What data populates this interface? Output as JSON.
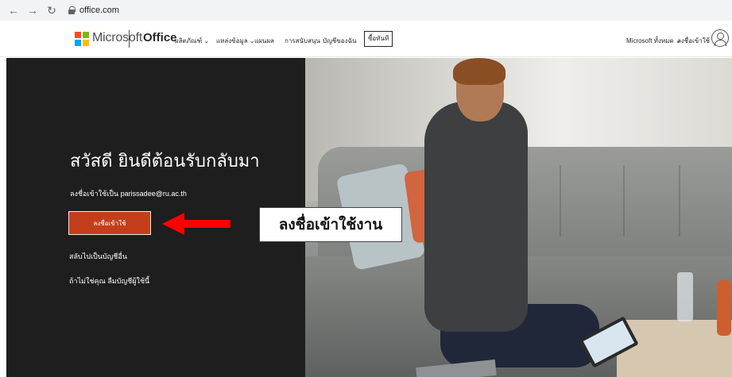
{
  "browser": {
    "url": "office.com",
    "icons": {
      "back": "arrow-left-icon",
      "forward": "arrow-right-icon",
      "reload": "reload-icon",
      "lock": "lock-icon"
    }
  },
  "header": {
    "brand": "Microsoft",
    "product": "Office",
    "nav": [
      {
        "label": "ผลิตภัณฑ์",
        "has_menu": true
      },
      {
        "label": "แหล่งข้อมูล",
        "has_menu": true
      },
      {
        "label": "แผนผล",
        "has_menu": false
      },
      {
        "label": "การสนับสนุน",
        "has_menu": false
      },
      {
        "label": "บัญชีของฉัน",
        "has_menu": false
      }
    ],
    "buy_button": "ซื้อทันที",
    "more_microsoft": "Microsoft ทั้งหมด",
    "sign_in": "ลงชื่อเข้าใช้"
  },
  "hero": {
    "title": "สวัสดี ยินดีต้อนรับกลับมา",
    "account_prefix": "ลงชื่อเข้าใช้เป็น",
    "account_email": "parissadee@ru.ac.th",
    "signin_button": "ลงชื่อเข้าใช้",
    "switch_account": "สลับไปเป็นบัญชีอื่น",
    "forget_account": "ถ้าไม่ใช่คุณ ลืมบัญชีผู้ใช้นี้"
  },
  "annotation": {
    "callout_text": "ลงชื่อเข้าใช้งาน",
    "arrow_color": "#ff0000"
  },
  "colors": {
    "signin_button_bg": "#c43e1c",
    "hero_dark_bg": "#1e1e1e",
    "ms_red": "#f25022",
    "ms_green": "#7fba00",
    "ms_blue": "#00a4ef",
    "ms_yellow": "#ffb900"
  }
}
